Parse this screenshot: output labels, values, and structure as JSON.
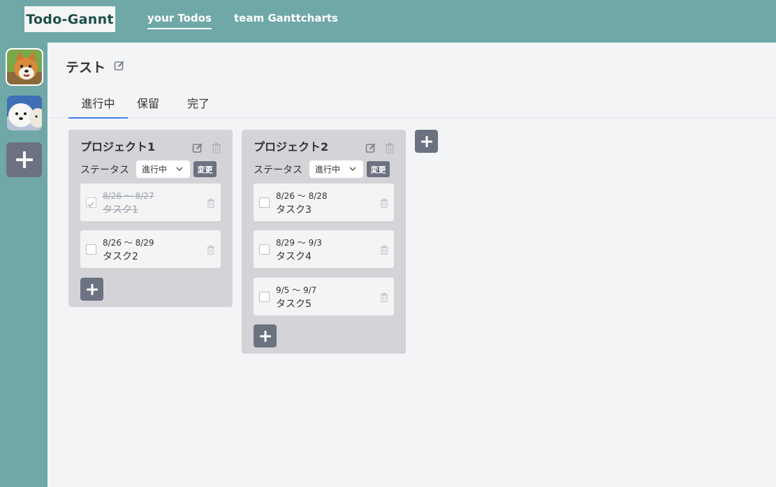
{
  "app": {
    "logo": "Todo-Gannt"
  },
  "nav": {
    "your_todos": "your Todos",
    "team_ganttcharts": "team Ganttcharts"
  },
  "sidebar": {
    "add_label": "+"
  },
  "page": {
    "title": "テスト"
  },
  "tabs": [
    {
      "label": "進行中"
    },
    {
      "label": "保留"
    },
    {
      "label": "完了"
    }
  ],
  "columns": [
    {
      "title": "プロジェクト1",
      "status_label": "ステータス",
      "status_value": "進行中",
      "change_label": "変更",
      "tasks": [
        {
          "dates": "8/26 〜 8/27",
          "name": "タスク1",
          "done": true
        },
        {
          "dates": "8/26 〜 8/29",
          "name": "タスク2",
          "done": false
        }
      ]
    },
    {
      "title": "プロジェクト2",
      "status_label": "ステータス",
      "status_value": "進行中",
      "change_label": "変更",
      "tasks": [
        {
          "dates": "8/26 〜 8/28",
          "name": "タスク3",
          "done": false
        },
        {
          "dates": "8/29 〜 9/3",
          "name": "タスク4",
          "done": false
        },
        {
          "dates": "9/5 〜 9/7",
          "name": "タスク5",
          "done": false
        }
      ]
    }
  ],
  "add_symbol": "+",
  "colors": {
    "header": "#6fa8a7",
    "button": "#6c7280",
    "column_bg": "#d4d4d8",
    "tab_active": "#3b82f6"
  }
}
